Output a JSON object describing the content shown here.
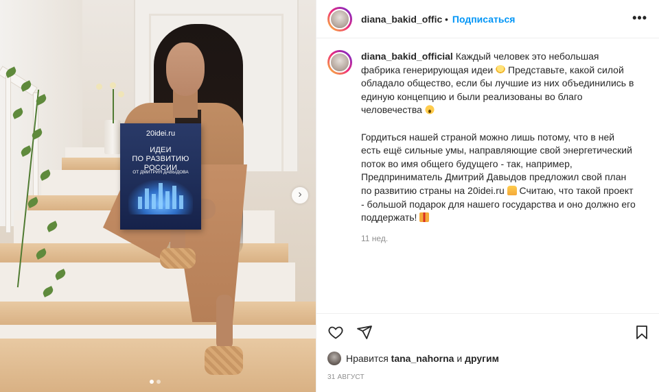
{
  "post": {
    "username": "diana_bakid_official",
    "header_separator": "•",
    "follow_label": "Подписаться",
    "more_label": "•••",
    "next_photo_label": "›",
    "photo_count": 2,
    "active_photo_index": 0
  },
  "book": {
    "site": "20idei.ru",
    "title_line1": "ИДЕИ",
    "title_line2": "ПО РАЗВИТИЮ РОССИИ",
    "author": "ОТ ДМИТРИЯ ДАВЫДОВА"
  },
  "caption": {
    "username": "diana_bakid_official",
    "p1_part1": "Каждый человек это небольшая фабрика генерирующая идеи",
    "p1_part2": "Представьте, какой силой обладало общество, если бы лучшие из них объединились в единую концепцию и были реализованы во благо человечества",
    "p2_part1": "Гордиться нашей страной можно лишь потому, что в ней есть ещё сильные умы, направляющие свой энергетический поток во имя общего будущего - так, например, Предприниматель Дмитрий Давыдов предложил свой план по развитию страны на 20idei.ru",
    "p2_part2": "Считаю, что такой проект - большой подарок для нашего государства и оно должно его поддержать!",
    "emoji_1": "light-bulb",
    "emoji_2": "astonished-face",
    "emoji_3": "raising-hands",
    "emoji_4": "gift",
    "time_ago": "11 нед."
  },
  "likes": {
    "prefix": "Нравится",
    "user": "tana_nahorna",
    "conj": "и",
    "others": "другим"
  },
  "date": "31 АВГУСТ",
  "colors": {
    "follow_blue": "#0095f6",
    "text": "#262626",
    "muted": "#8e8e8e",
    "divider": "#efefef"
  },
  "icons": [
    "heart-icon",
    "share-icon",
    "bookmark-icon",
    "more-icon",
    "chevron-right-icon"
  ]
}
